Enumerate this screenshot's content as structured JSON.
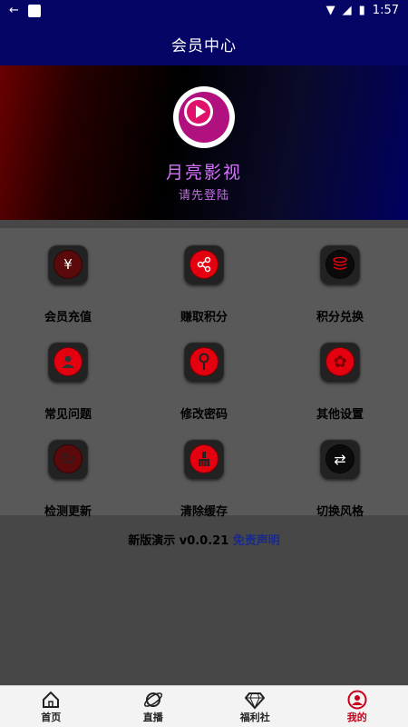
{
  "status": {
    "time": "1:57"
  },
  "header": {
    "title": "会员中心"
  },
  "profile": {
    "app_name": "月亮影视",
    "login_prompt": "请先登陆"
  },
  "grid": {
    "items": [
      {
        "label": "会员充值",
        "icon": "yen-icon"
      },
      {
        "label": "赚取积分",
        "icon": "share-icon"
      },
      {
        "label": "积分兑换",
        "icon": "coin-stack-icon"
      },
      {
        "label": "常见问题",
        "icon": "person-icon"
      },
      {
        "label": "修改密码",
        "icon": "key-icon"
      },
      {
        "label": "其他设置",
        "icon": "gear-icon"
      },
      {
        "label": "检测更新",
        "icon": "refresh-icon"
      },
      {
        "label": "清除缓存",
        "icon": "broom-icon"
      },
      {
        "label": "切换风格",
        "icon": "swap-icon"
      }
    ]
  },
  "footer": {
    "version": "新版演示 v0.0.21",
    "disclaimer": "免责声明"
  },
  "tabs": [
    {
      "label": "首页",
      "icon": "home-icon"
    },
    {
      "label": "直播",
      "icon": "planet-icon"
    },
    {
      "label": "福利社",
      "icon": "diamond-icon"
    },
    {
      "label": "我的",
      "icon": "profile-icon",
      "active": true
    }
  ],
  "colors": {
    "accent": "#c4001a",
    "header": "#050566",
    "icon_red": "#e5000f"
  }
}
